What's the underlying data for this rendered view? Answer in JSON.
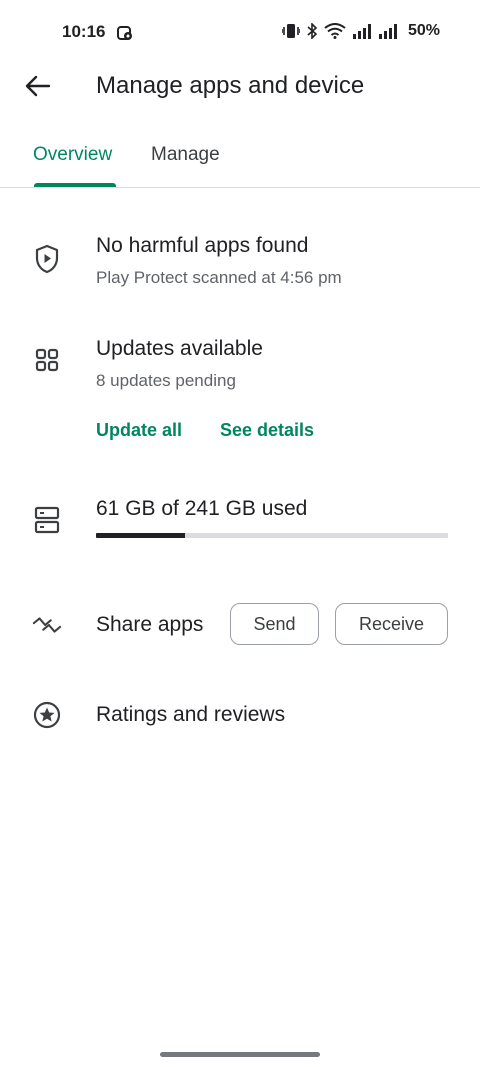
{
  "status_bar": {
    "time": "10:16",
    "battery": "50%",
    "icons": [
      "screen-record-icon",
      "vibrate-icon",
      "bluetooth-icon",
      "wifi-icon",
      "signal-icon",
      "signal-icon-2"
    ]
  },
  "header": {
    "title": "Manage apps and device",
    "back_icon": "arrow-back-icon"
  },
  "tabs": [
    {
      "label": "Overview",
      "active": true
    },
    {
      "label": "Manage",
      "active": false
    }
  ],
  "protect": {
    "icon": "play-protect-shield-icon",
    "title": "No harmful apps found",
    "subtitle": "Play Protect scanned at 4:56 pm"
  },
  "updates": {
    "icon": "apps-grid-icon",
    "title": "Updates available",
    "subtitle": "8 updates pending",
    "update_all": "Update all",
    "see_details": "See details"
  },
  "storage": {
    "icon": "storage-icon",
    "title": "61 GB of 241 GB used",
    "used_gb": 61,
    "total_gb": 241
  },
  "share": {
    "icon": "share-apps-icon",
    "title": "Share apps",
    "send": "Send",
    "receive": "Receive"
  },
  "ratings": {
    "icon": "star-circle-icon",
    "title": "Ratings and reviews"
  },
  "colors": {
    "accent": "#01875f",
    "text": "#202124",
    "secondary_text": "#5f6368"
  }
}
